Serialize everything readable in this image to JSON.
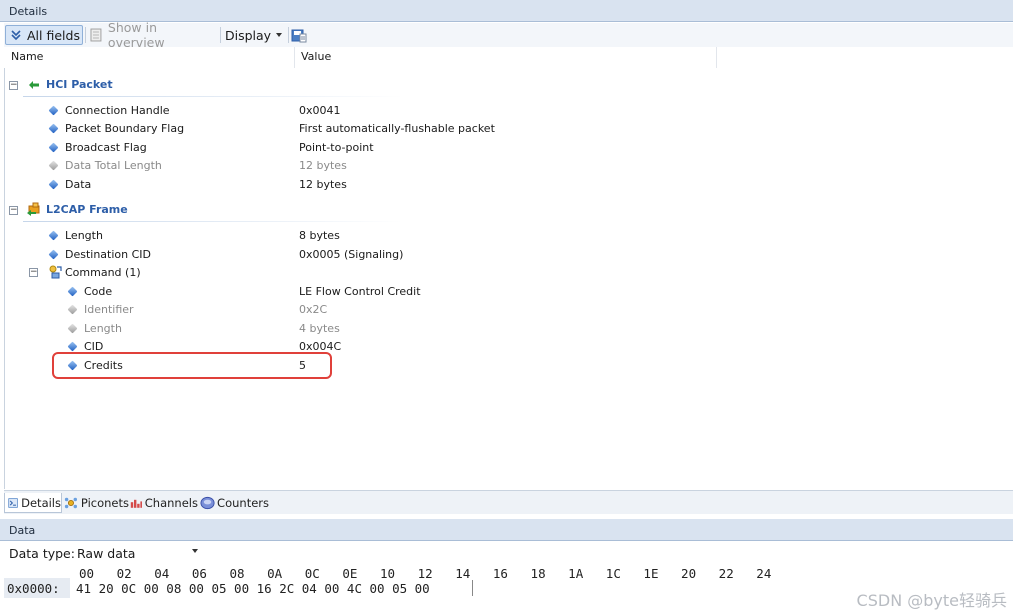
{
  "details_panel": {
    "title": "Details",
    "toolbar": {
      "all_fields_label": "All fields",
      "show_in_overview_label": "Show in overview",
      "display_label": "Display"
    },
    "columns": {
      "name": "Name",
      "value": "Value"
    },
    "groups": [
      {
        "label": "HCI Packet",
        "icon": "green-arrow-left-icon",
        "fields": [
          {
            "name": "Connection Handle",
            "value": "0x0041",
            "enabled": true
          },
          {
            "name": "Packet Boundary Flag",
            "value": "First automatically-flushable packet",
            "enabled": true
          },
          {
            "name": "Broadcast Flag",
            "value": "Point-to-point",
            "enabled": true
          },
          {
            "name": "Data Total Length",
            "value": "12 bytes",
            "enabled": false
          },
          {
            "name": "Data",
            "value": "12 bytes",
            "enabled": true
          }
        ]
      },
      {
        "label": "L2CAP Frame",
        "icon": "l2cap-frame-icon",
        "fields": [
          {
            "name": "Length",
            "value": "8 bytes",
            "enabled": true
          },
          {
            "name": "Destination CID",
            "value": "0x0005 (Signaling)",
            "enabled": true
          }
        ],
        "subgroup": {
          "label": "Command (1)",
          "icon": "command-icon",
          "fields": [
            {
              "name": "Code",
              "value": "LE Flow Control Credit",
              "enabled": true
            },
            {
              "name": "Identifier",
              "value": "0x2C",
              "enabled": false
            },
            {
              "name": "Length",
              "value": "4 bytes",
              "enabled": false
            },
            {
              "name": "CID",
              "value": "0x004C",
              "enabled": true
            },
            {
              "name": "Credits",
              "value": "5",
              "enabled": true
            }
          ]
        }
      }
    ]
  },
  "bottom_tabs": [
    {
      "label": "Details",
      "icon": "details-icon",
      "active": true
    },
    {
      "label": "Piconets",
      "icon": "piconets-icon",
      "active": false
    },
    {
      "label": "Channels",
      "icon": "channels-icon",
      "active": false
    },
    {
      "label": "Counters",
      "icon": "counters-icon",
      "active": false
    }
  ],
  "data_panel": {
    "title": "Data",
    "data_type_label": "Data type:",
    "data_type_value": "Raw data",
    "hex_header": "00   02   04   06   08   0A   0C   0E   10   12   14   16   18   1A   1C   1E   20   22   24",
    "rows": [
      {
        "offset": "0x0000:",
        "bytes": "41 20 0C 00 08 00 05 00 16 2C 04 00 4C 00 05 00"
      }
    ]
  },
  "watermark": "CSDN @byte轻骑兵",
  "colors": {
    "highlight": "#e0403a",
    "group_label": "#2d5ea8",
    "panel_header": "#d9e3f0"
  }
}
